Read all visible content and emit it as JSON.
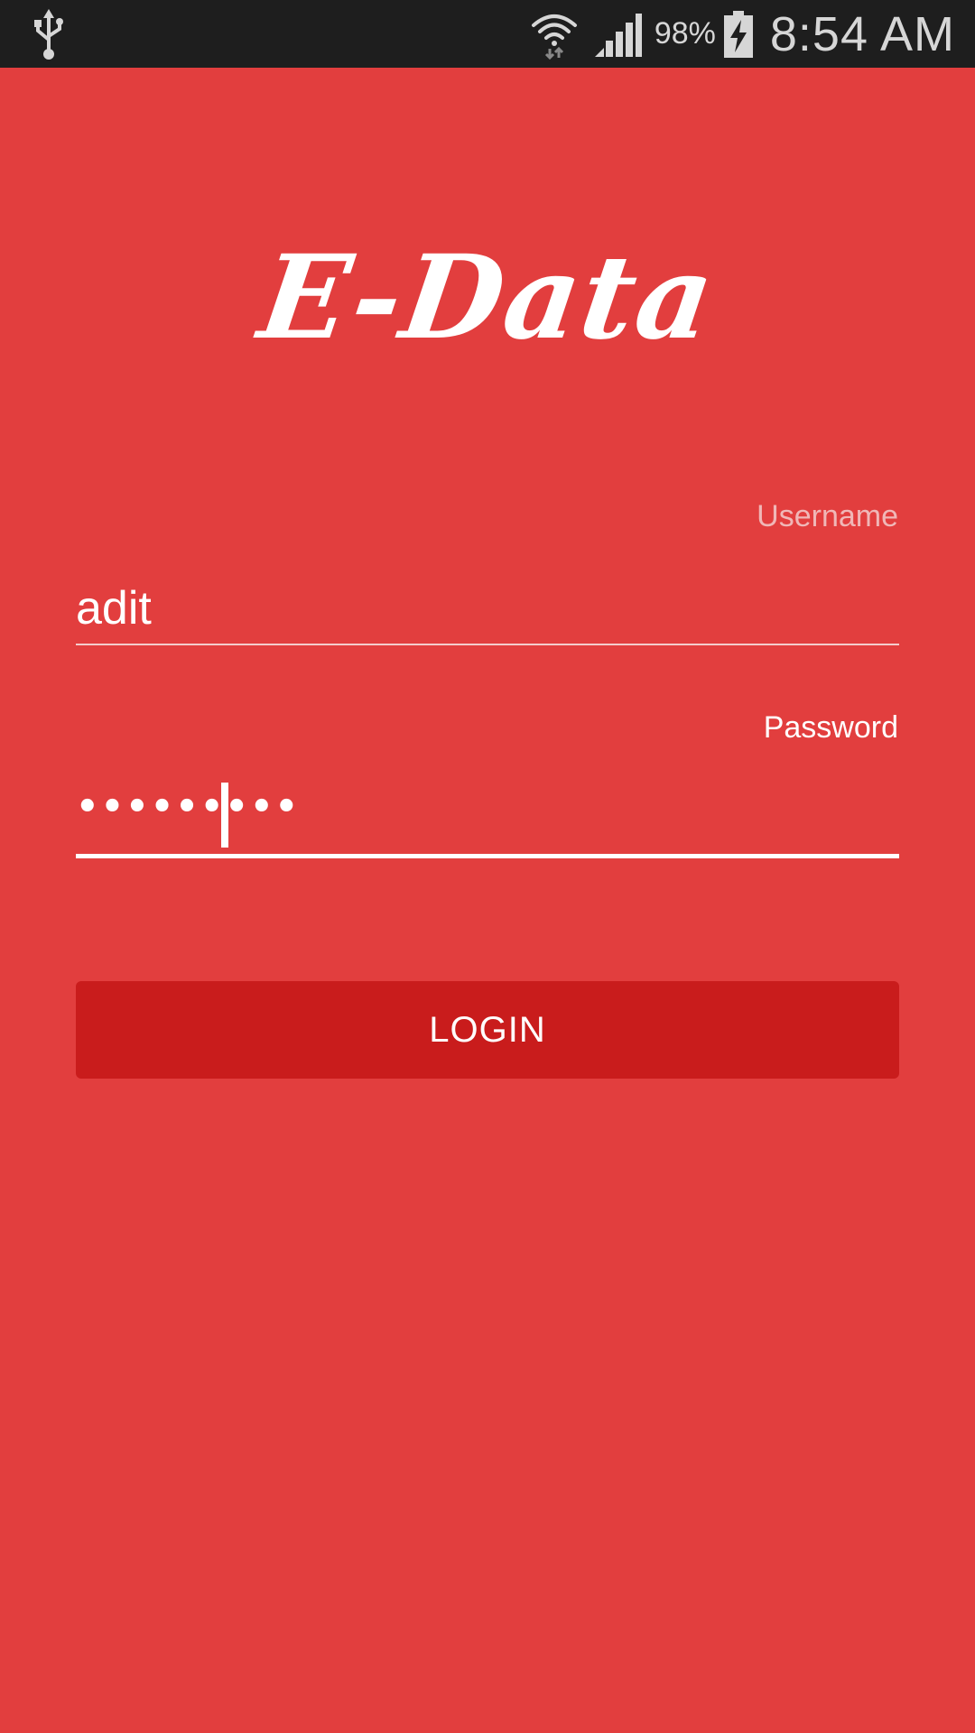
{
  "status_bar": {
    "usb_icon": "usb-icon",
    "wifi_icon": "wifi-icon",
    "signal_icon": "signal-icon",
    "battery_percent": "98%",
    "battery_icon": "battery-charging-icon",
    "time": "8:54 AM"
  },
  "app": {
    "logo_text": "E-Data",
    "accent_color": "#e23e3e",
    "button_color": "#c91c1c"
  },
  "form": {
    "username_label": "Username",
    "username_value": "adit",
    "password_label": "Password",
    "password_masked": "•••••••••",
    "login_label": "LOGIN"
  }
}
